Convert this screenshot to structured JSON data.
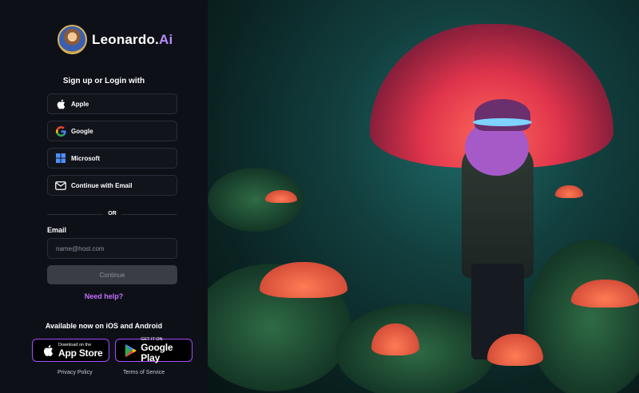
{
  "brand": {
    "name": "Leonardo",
    "suffix": "Ai",
    "dot": "."
  },
  "auth": {
    "heading": "Sign up or Login with",
    "providers": [
      {
        "label": "Apple",
        "icon": "apple-icon"
      },
      {
        "label": "Google",
        "icon": "google-icon"
      },
      {
        "label": "Microsoft",
        "icon": "microsoft-icon"
      },
      {
        "label": "Continue with Email",
        "icon": "mail-icon"
      }
    ],
    "or": "OR",
    "email_label": "Email",
    "email_placeholder": "name@host.com",
    "email_value": "",
    "continue_label": "Continue",
    "help_label": "Need help?"
  },
  "apps": {
    "heading": "Available now on iOS and Android",
    "appstore": {
      "small": "Download on the",
      "big": "App Store"
    },
    "googleplay": {
      "small": "GET IT ON",
      "big": "Google Play"
    }
  },
  "footer": {
    "privacy": "Privacy Policy",
    "terms": "Terms of Service"
  },
  "colors": {
    "accent": "#c56dff",
    "store_border": "#a64cff",
    "panel_bg": "#0e1017"
  }
}
